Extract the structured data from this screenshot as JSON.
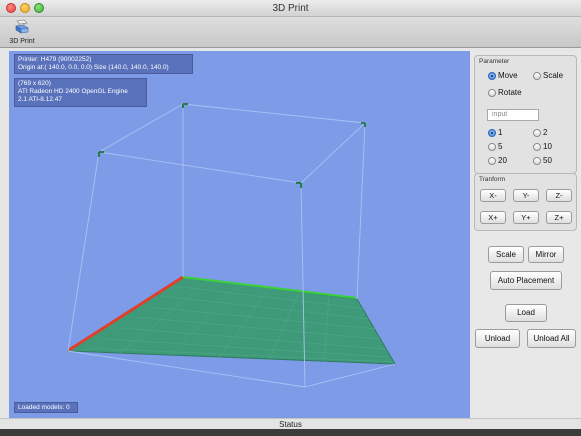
{
  "window": {
    "title": "3D Print"
  },
  "toolbar": {
    "print_label": "3D Print",
    "print_icon": "printer-3d-icon"
  },
  "viewport": {
    "printer_line1": "Printer: H479 (90002252)",
    "printer_line2": "Origin at:( 140.0, 0.0, 0.0)   Size (140.0, 140.0, 140.0)",
    "gl_line1": "(769 x 620)",
    "gl_line2": "ATI Radeon HD 2400 OpenGL Engine",
    "gl_line3": "2.1 ATI-8.12.47",
    "loaded_models": "Loaded models: 0",
    "colors": {
      "background": "#7e9be8",
      "bed": "#3f9a7a",
      "x_axis": "#e0402a",
      "y_axis": "#3ad13a"
    }
  },
  "parameter": {
    "title": "Parameter",
    "mode_options": [
      {
        "label": "Move",
        "selected": true
      },
      {
        "label": "Scale",
        "selected": false
      },
      {
        "label": "Rotate",
        "selected": false
      }
    ],
    "input_placeholder": "input",
    "step_options": [
      {
        "label": "1",
        "selected": true
      },
      {
        "label": "2",
        "selected": false
      },
      {
        "label": "5",
        "selected": false
      },
      {
        "label": "10",
        "selected": false
      },
      {
        "label": "20",
        "selected": false
      },
      {
        "label": "50",
        "selected": false
      }
    ]
  },
  "transform": {
    "title": "Tranform",
    "buttons": [
      "X-",
      "Y-",
      "Z-",
      "X+",
      "Y+",
      "Z+"
    ]
  },
  "actions": {
    "scale": "Scale",
    "mirror": "Mirror",
    "auto_placement": "Auto Placement",
    "load": "Load",
    "unload": "Unload",
    "unload_all": "Unload All"
  },
  "status": {
    "text": "Status"
  }
}
